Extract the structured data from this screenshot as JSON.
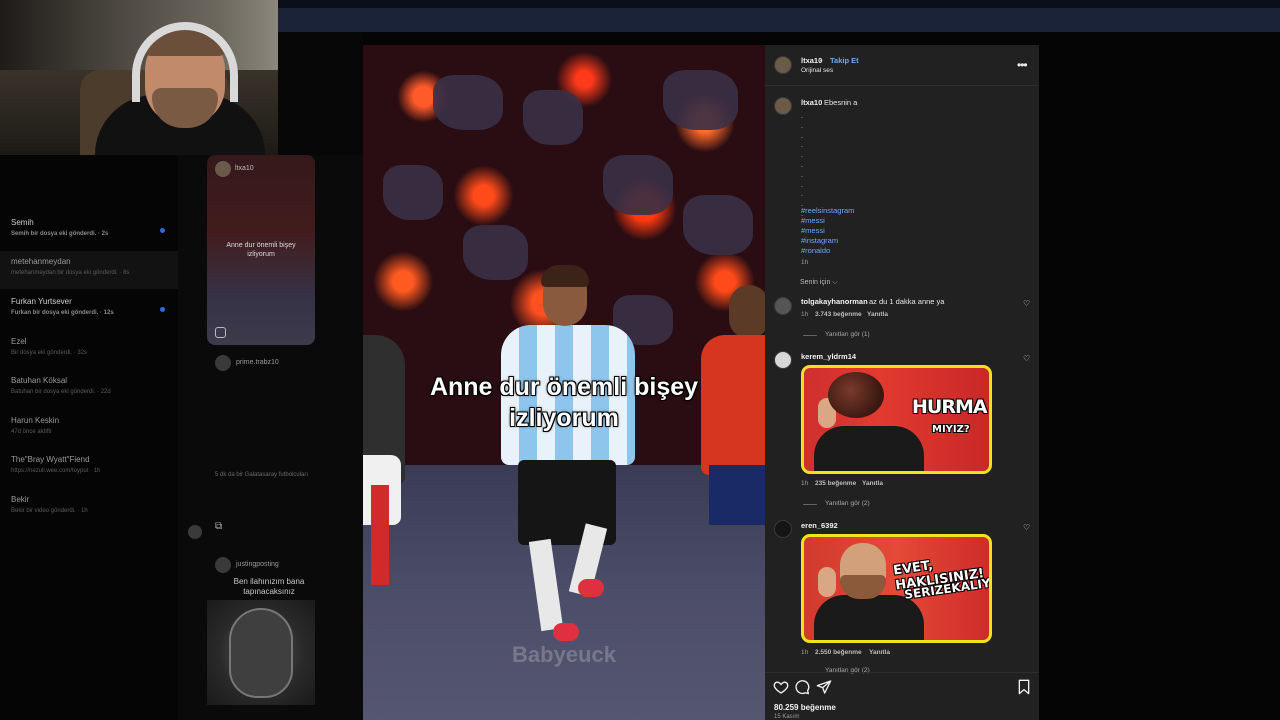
{
  "dm_list": [
    {
      "name": "Semih",
      "sub": "Semih bir dosya eki gönderdi. · 2s",
      "unread": true
    },
    {
      "name": "metehanmeydan",
      "sub": "metehanmeydan bir dosya eki gönderdi. · 8s",
      "unread": false
    },
    {
      "name": "Furkan Yurtsever",
      "sub": "Furkan bir dosya eki gönderdi. · 12s",
      "unread": true
    },
    {
      "name": "Ezel",
      "sub": "Bir dosya eki gönderdi. · 32s",
      "unread": false
    },
    {
      "name": "Batuhan Köksal",
      "sub": "Batuhan bir dosya eki gönderdi. · 22d",
      "unread": false
    },
    {
      "name": "Harun Keskin",
      "sub": "47d önce aktifti",
      "unread": false
    },
    {
      "name": "The\"Bray Wyatt\"Fiend",
      "sub": "https://nezuli.wee.com/toyput · 1h",
      "unread": false
    },
    {
      "name": "Bekir",
      "sub": "Bekir bir video gönderdi. · 1h",
      "unread": false
    }
  ],
  "chat": {
    "card_user": "ltxa10",
    "card_caption": "Anne dur önemli bişey izliyorum",
    "sender1": "prime.trabz10",
    "message1": "5 dk da bir Galatasaray futbolcuları",
    "sender2": "justingposting",
    "message2": "Ben ilahınızım bana tapınacaksınız"
  },
  "video": {
    "caption_line1": "Anne dur önemli bişey",
    "caption_line2": "izliyorum",
    "watermark": "Babyeuck"
  },
  "post": {
    "username": "ltxa10",
    "follow_label": "Takip Et",
    "audio": "Orijinal ses",
    "caption_user": "ltxa10",
    "caption_text": "Ebesnin a",
    "hashtags": [
      "#reelsinstagram",
      "#messi",
      "#messi",
      "#instagram",
      "#ronaldo"
    ],
    "caption_time": "1h",
    "sort_label": "Senin için ⌵",
    "likes": "80.259 beğenme",
    "date": "15 Kasım"
  },
  "comments": [
    {
      "user": "tolgakayhanorman",
      "text": "az du 1 dakka anne ya",
      "time": "1h",
      "likes": "3.743 beğenme",
      "reply": "Yanıtla",
      "view_replies": "Yanıtları gör (1)"
    },
    {
      "user": "kerem_yldrm14",
      "time": "1h",
      "likes": "235 beğenme",
      "reply": "Yanıtla",
      "view_replies": "Yanıtları gör (2)",
      "image_text1": "HURMA",
      "image_text2": "MIYIZ?"
    },
    {
      "user": "eren_6392",
      "time": "1h",
      "likes": "2.550 beğenme",
      "reply": "Yanıtla",
      "view_replies": "Yanıtları gör (2)",
      "image_text1": "EVET, HAKLISINIZ!",
      "image_text2": "SERIZEKALIYIZ"
    }
  ],
  "icons": {
    "more": "more-horizontal-icon",
    "heart": "heart-icon",
    "comment": "comment-icon",
    "share": "send-icon",
    "save": "bookmark-icon"
  },
  "colors": {
    "link": "#6ea8ff",
    "panel_bg": "#212121",
    "thumb_border": "#f4e21c"
  }
}
